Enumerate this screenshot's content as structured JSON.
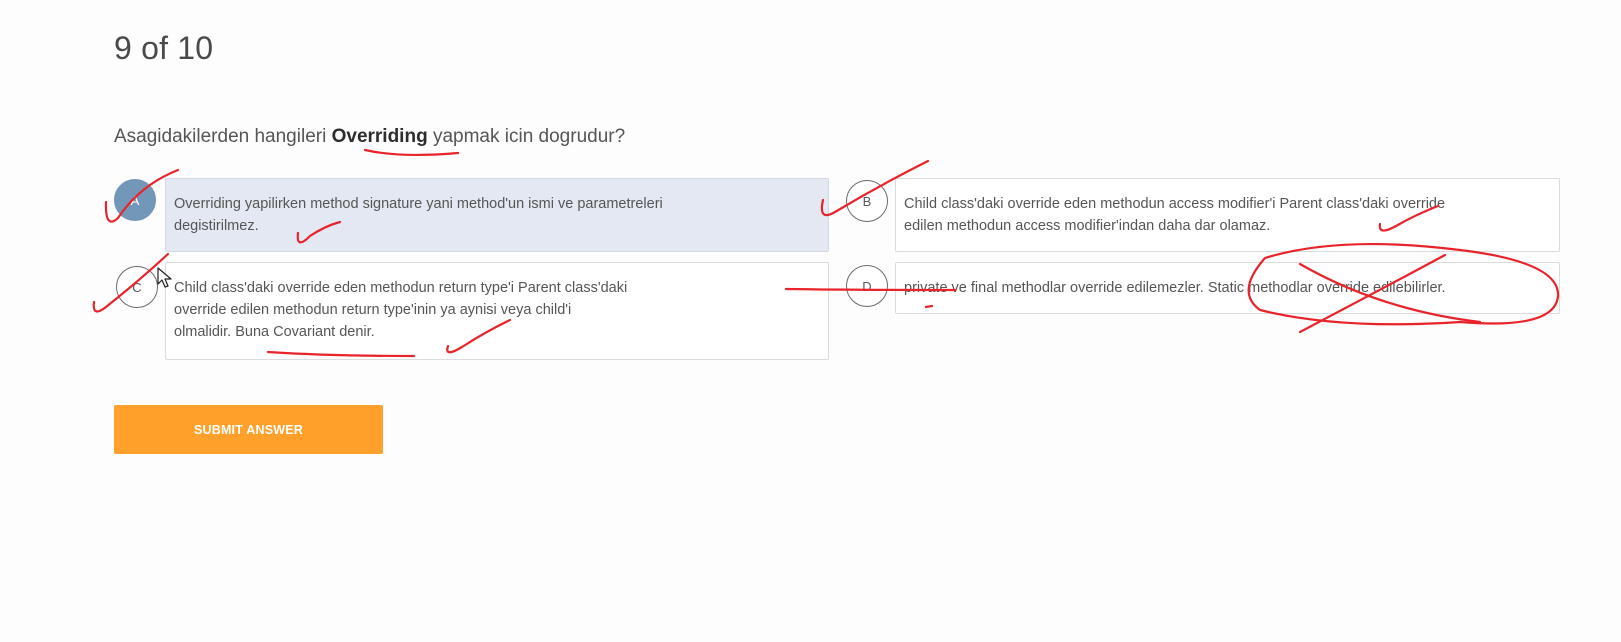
{
  "quiz": {
    "progress": "9 of 10",
    "question": {
      "prefix": "Asagidakilerden hangileri ",
      "keyword": "Overriding",
      "suffix": " yapmak icin dogrudur?"
    },
    "options": [
      {
        "letter": "A",
        "selected": true,
        "text": "Overriding yapilirken method signature yani method'un ismi ve parametreleri\ndegistirilmez."
      },
      {
        "letter": "B",
        "selected": false,
        "text": "Child class'daki override eden methodun access modifier'i Parent class'daki override\nedilen methodun access modifier'indan daha dar olamaz."
      },
      {
        "letter": "C",
        "selected": false,
        "text": "Child class'daki override eden methodun return type'i Parent class'daki\n override edilen methodun return type'inin ya aynisi veya child'i\nolmalidir. Buna Covariant denir."
      },
      {
        "letter": "D",
        "selected": false,
        "text": "private ve final methodlar override edilemezler. Static methodlar override edilebilirler."
      }
    ],
    "submit_label": "SUBMIT ANSWER"
  },
  "colors": {
    "accent": "#ffa02a",
    "selected_badge": "#7397b8",
    "selected_option_bg": "#e3e8f3",
    "annotation_ink": "#e8232a"
  },
  "icons": {
    "cursor": "arrow-pointer-icon"
  }
}
